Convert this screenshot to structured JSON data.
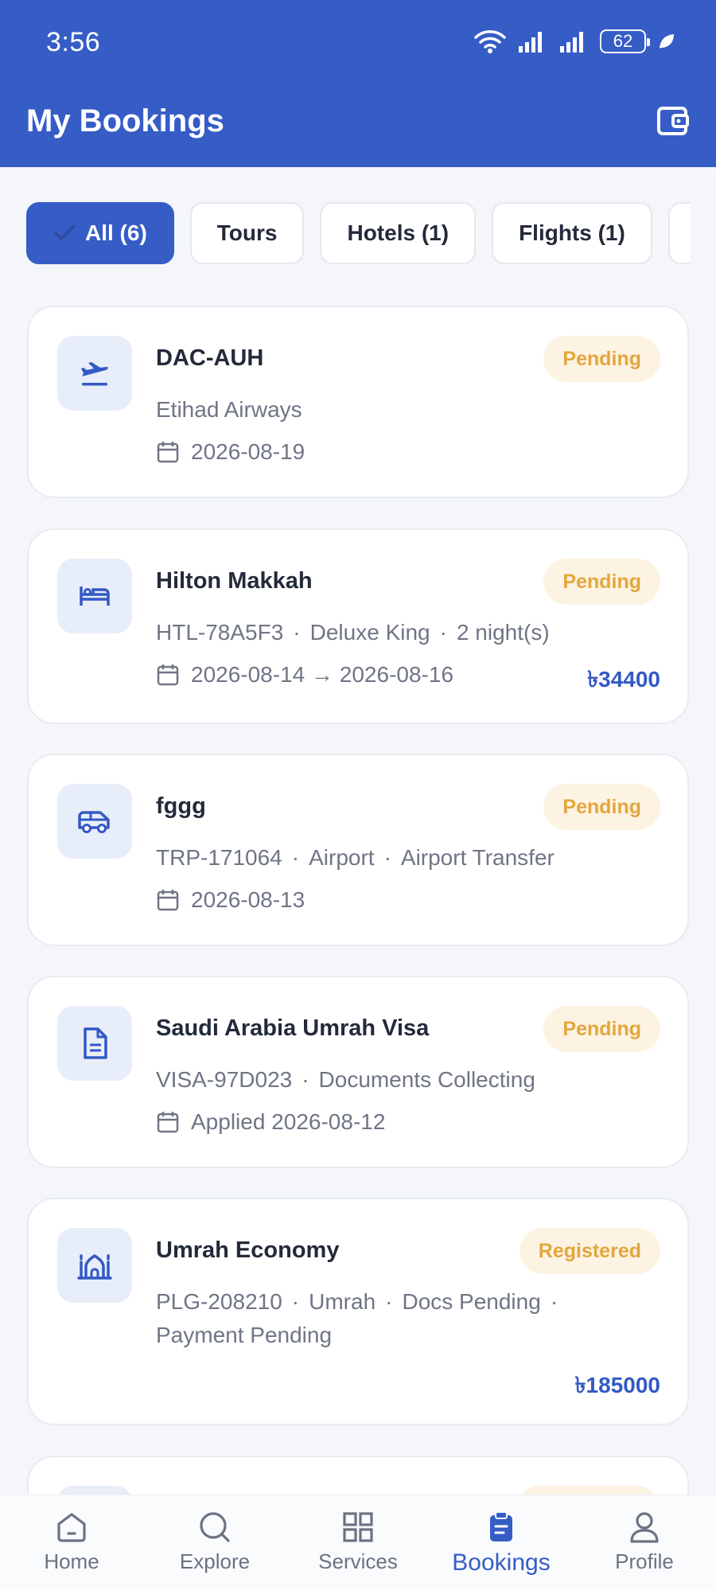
{
  "status": {
    "time": "3:56",
    "battery": "62"
  },
  "header": {
    "title": "My Bookings",
    "wallet_icon": "wallet-icon"
  },
  "filters": [
    {
      "label": "All (6)",
      "active": true
    },
    {
      "label": "Tours",
      "active": false
    },
    {
      "label": "Hotels (1)",
      "active": false
    },
    {
      "label": "Flights (1)",
      "active": false
    }
  ],
  "bookings": [
    {
      "icon": "plane-icon",
      "title": "DAC-AUH",
      "status": "Pending",
      "sub": [
        "Etihad Airways"
      ],
      "date": "2026-08-19",
      "price": ""
    },
    {
      "icon": "bed-icon",
      "title": "Hilton Makkah",
      "status": "Pending",
      "sub": [
        "HTL-78A5F3",
        "Deluxe King",
        "2 night(s)"
      ],
      "date": "2026-08-14 → 2026-08-16",
      "price": "৳34400"
    },
    {
      "icon": "van-icon",
      "title": "fggg",
      "status": "Pending",
      "sub": [
        "TRP-171064",
        "Airport",
        "Airport Transfer"
      ],
      "date": "2026-08-13",
      "price": ""
    },
    {
      "icon": "document-icon",
      "title": "Saudi Arabia Umrah Visa",
      "status": "Pending",
      "sub": [
        "VISA-97D023",
        "Documents Collecting"
      ],
      "date": "Applied 2026-08-12",
      "price": ""
    },
    {
      "icon": "mosque-icon",
      "title": "Umrah Economy",
      "status": "Registered",
      "sub_line1": "PLG-208210",
      "sub_line1b": "Umrah",
      "sub_line1c": "Docs Pending",
      "sub_line2": "Payment Pending",
      "price": "৳185000"
    }
  ],
  "nav": [
    {
      "label": "Home",
      "icon": "home-icon"
    },
    {
      "label": "Explore",
      "icon": "search-icon"
    },
    {
      "label": "Services",
      "icon": "grid-icon"
    },
    {
      "label": "Bookings",
      "icon": "clipboard-icon",
      "active": true
    },
    {
      "label": "Profile",
      "icon": "user-icon"
    }
  ],
  "colors": {
    "primary": "#365cc6",
    "pending_text": "#e2a73d",
    "pending_bg": "#fdf3e2"
  }
}
